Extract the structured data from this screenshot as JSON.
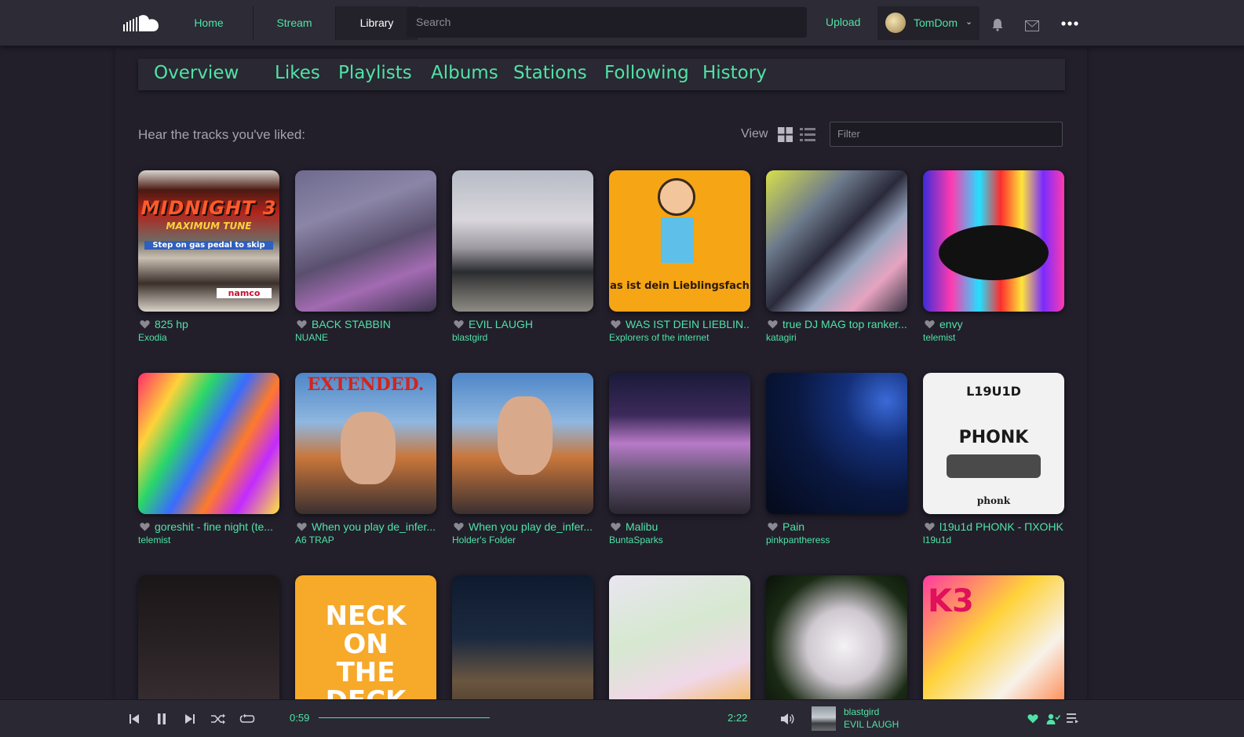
{
  "header": {
    "nav": [
      {
        "label": "Home"
      },
      {
        "label": "Stream"
      },
      {
        "label": "Library"
      }
    ],
    "search_placeholder": "Search",
    "upload_label": "Upload",
    "username": "TomDom",
    "icons": [
      "soundcloud-logo",
      "bell-icon",
      "mail-icon",
      "more-icon"
    ]
  },
  "tabs": [
    {
      "label": "Overview"
    },
    {
      "label": "Likes"
    },
    {
      "label": "Playlists"
    },
    {
      "label": "Albums"
    },
    {
      "label": "Stations"
    },
    {
      "label": "Following"
    },
    {
      "label": "History"
    }
  ],
  "main": {
    "subheading": "Hear the tracks you've liked:",
    "view_label": "View",
    "filter_placeholder": "Filter"
  },
  "tracks": [
    {
      "title": "825 hp",
      "artist": "Exodia"
    },
    {
      "title": "BACK STABBIN",
      "artist": "NUANE"
    },
    {
      "title": "EVIL LAUGH",
      "artist": "blastgird"
    },
    {
      "title": "WAS IST DEIN LIEBLIN...",
      "artist": "Explorers of the internet"
    },
    {
      "title": "true DJ MAG top ranker...",
      "artist": "katagiri"
    },
    {
      "title": "envy",
      "artist": "telemist"
    },
    {
      "title": "goreshit - fine night (te...",
      "artist": "telemist"
    },
    {
      "title": "When you play de_infer...",
      "artist": "A6 TRAP"
    },
    {
      "title": "When you play de_infer...",
      "artist": "Holder's Folder"
    },
    {
      "title": "Malibu",
      "artist": "BuntaSparks"
    },
    {
      "title": "Pain",
      "artist": "pinkpantheress"
    },
    {
      "title": "l19u1d PHONK - ПXOHK",
      "artist": "l19u1d"
    },
    {
      "title": "",
      "artist": ""
    },
    {
      "title": "",
      "artist": ""
    },
    {
      "title": "",
      "artist": ""
    },
    {
      "title": "",
      "artist": ""
    },
    {
      "title": "",
      "artist": ""
    },
    {
      "title": "",
      "artist": ""
    }
  ],
  "art_text": {
    "t1_brand": "MIDNIGHT 3",
    "t1_sub": "MAXIMUM TUNE",
    "t1_banner": "Step on gas pedal to skip",
    "t1_namco": "namco",
    "t4_caption": "as ist dein Lieblingsfach",
    "t8_caption": "EXTENDED.",
    "t12_top": "L19U1D",
    "t12_mid": "PHONK",
    "t12_bottom": "phonk",
    "t14_caption": "NECK ON THE DECK",
    "t18_caption": "K3"
  },
  "player": {
    "elapsed": "0:59",
    "duration": "2:22",
    "progress_fraction": 0.42,
    "now_playing_artist": "blastgird",
    "now_playing_title": "EVIL LAUGH"
  },
  "colors": {
    "accent": "#4fe3a6",
    "background": "#221f2a",
    "header": "#2d2b35"
  }
}
